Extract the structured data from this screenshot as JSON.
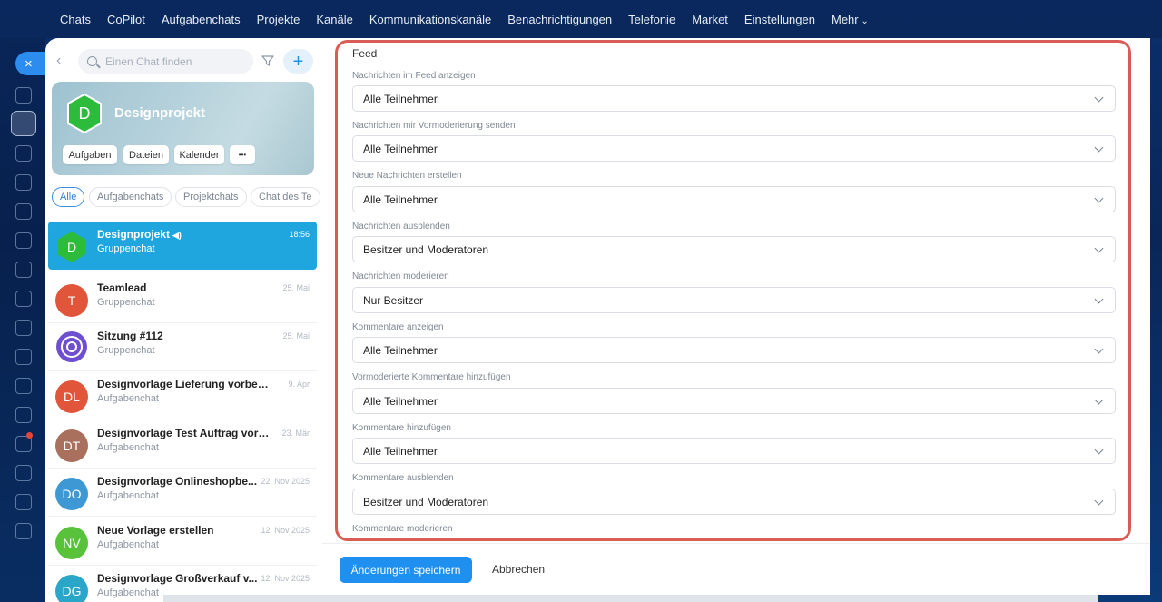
{
  "topnav": {
    "items": [
      "Chats",
      "CoPilot",
      "Aufgabenchats",
      "Projekte",
      "Kanäle",
      "Kommunikationskanäle",
      "Benachrichtigungen",
      "Telefonie",
      "Market",
      "Einstellungen"
    ],
    "more_label": "Mehr"
  },
  "rail": {
    "close_label": "×"
  },
  "search": {
    "placeholder": "Einen Chat finden"
  },
  "add_label": "+",
  "project": {
    "initial": "D",
    "name": "Designprojekt",
    "buttons": [
      "Aufgaben",
      "Dateien",
      "Kalender",
      "•••"
    ],
    "hex_color": "#2dbb3c"
  },
  "filters": [
    "Alle",
    "Aufgabenchats",
    "Projektchats",
    "Chat des Te"
  ],
  "chats": [
    {
      "initials": "D",
      "name": "Designprojekt",
      "sub": "Gruppenchat",
      "date": "18:56",
      "color": "#2dbb3c",
      "selected": true
    },
    {
      "initials": "T",
      "name": "Teamlead",
      "sub": "Gruppenchat",
      "date": "25. Mai",
      "color": "#e1553a"
    },
    {
      "initials": "",
      "name": "Sitzung #112",
      "sub": "Gruppenchat",
      "date": "25. Mai",
      "color": "#6d4fd0"
    },
    {
      "initials": "DL",
      "name": "Designvorlage Lieferung vorbereiten",
      "sub": "Aufgabenchat",
      "date": "9. Apr",
      "color": "#e1553a"
    },
    {
      "initials": "DT",
      "name": "Designvorlage Test Auftrag vorbe...",
      "sub": "Aufgabenchat",
      "date": "23. Mär",
      "color": "#a8705d"
    },
    {
      "initials": "DO",
      "name": "Designvorlage Onlineshopbe...",
      "sub": "Aufgabenchat",
      "date": "22. Nov 2025",
      "color": "#3d98d3"
    },
    {
      "initials": "NV",
      "name": "Neue Vorlage erstellen",
      "sub": "Aufgabenchat",
      "date": "12. Nov 2025",
      "color": "#58c23a"
    },
    {
      "initials": "DG",
      "name": "Designvorlage Großverkauf v...",
      "sub": "Aufgabenchat",
      "date": "12. Nov 2025",
      "color": "#2aa6c9"
    }
  ],
  "settings": {
    "section_title": "Feed",
    "fields": [
      {
        "label": "Nachrichten im Feed anzeigen",
        "value": "Alle Teilnehmer"
      },
      {
        "label": "Nachrichten mir Vormoderierung senden",
        "value": "Alle Teilnehmer"
      },
      {
        "label": "Neue Nachrichten erstellen",
        "value": "Alle Teilnehmer"
      },
      {
        "label": "Nachrichten ausblenden",
        "value": "Besitzer und Moderatoren"
      },
      {
        "label": "Nachrichten moderieren",
        "value": "Nur Besitzer"
      },
      {
        "label": "Kommentare anzeigen",
        "value": "Alle Teilnehmer"
      },
      {
        "label": "Vormoderierte Kommentare hinzufügen",
        "value": "Alle Teilnehmer"
      },
      {
        "label": "Kommentare hinzufügen",
        "value": "Alle Teilnehmer"
      },
      {
        "label": "Kommentare ausblenden",
        "value": "Besitzer und Moderatoren"
      },
      {
        "label": "Kommentare moderieren",
        "value": ""
      }
    ]
  },
  "actions": {
    "save_label": "Änderungen speichern",
    "cancel_label": "Abbrechen"
  },
  "colors": {
    "accent": "#1f8ff0",
    "highlight": "#d95c57",
    "selected_row": "#1fa6de"
  }
}
